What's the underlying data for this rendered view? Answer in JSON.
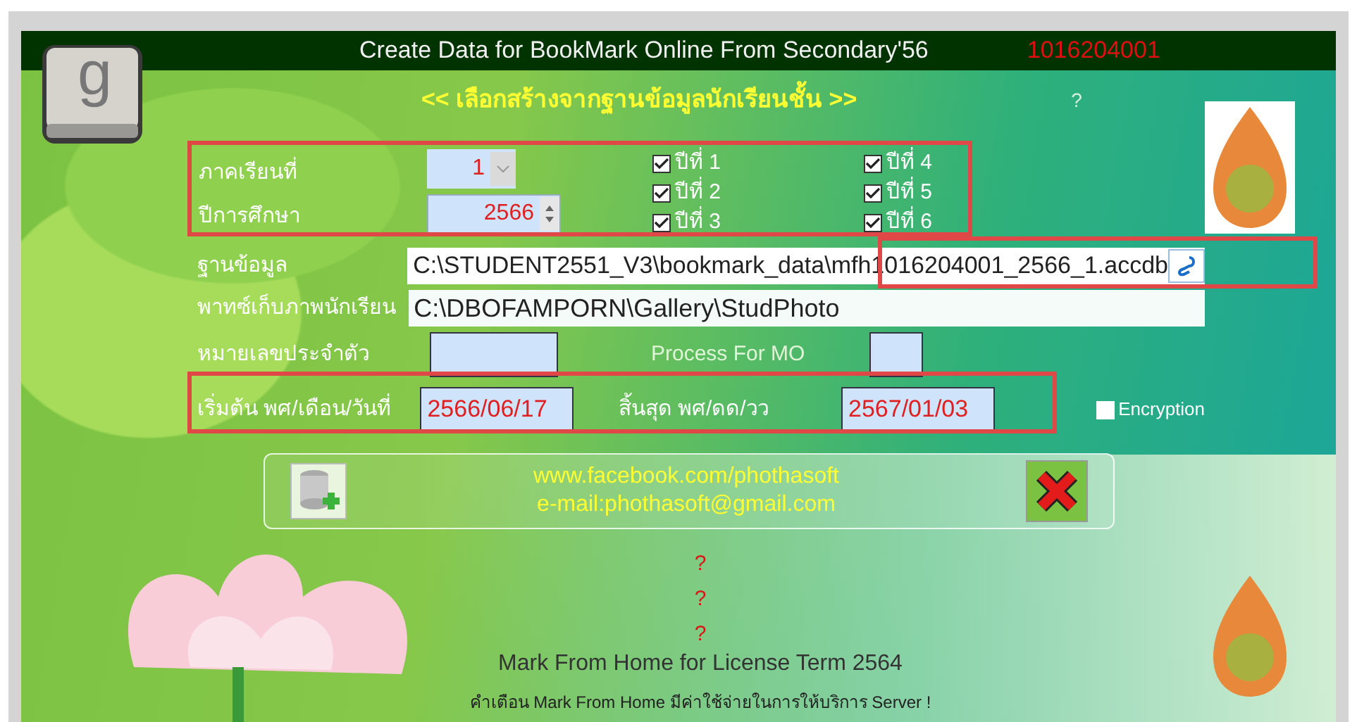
{
  "window": {
    "title": "Create Data for BookMark Online From Secondary'56",
    "code": "1016204001"
  },
  "logo": "g",
  "heading": "<< เลือกสร้างจากฐานข้อมูลนักเรียนชั้น >>",
  "help_mark": "?",
  "semester": {
    "label": "ภาคเรียนที่",
    "value": "1"
  },
  "year": {
    "label": "ปีการศึกษา",
    "value": "2566"
  },
  "grades": [
    {
      "label": "ปีที่ 1",
      "checked": true
    },
    {
      "label": "ปีที่ 2",
      "checked": true
    },
    {
      "label": "ปีที่ 3",
      "checked": true
    },
    {
      "label": "ปีที่ 4",
      "checked": true
    },
    {
      "label": "ปีที่ 5",
      "checked": true
    },
    {
      "label": "ปีที่ 6",
      "checked": true
    }
  ],
  "database": {
    "label": "ฐานข้อมูล",
    "value": "C:\\STUDENT2551_V3\\bookmark_data\\mfh1016204001_2566_1.accdb"
  },
  "photo_path": {
    "label": "พาทซ์เก็บภาพนักเรียน",
    "value": "C:\\DBOFAMPORN\\Gallery\\StudPhoto"
  },
  "id_number": {
    "label": "หมายเลขประจำตัว"
  },
  "process_mo": {
    "label": "Process For MO"
  },
  "start_date": {
    "label": "เริ่มต้น พศ/เดือน/วันที่",
    "value": "2566/06/17"
  },
  "end_date": {
    "label": "สิ้นสุด พศ/ดด/วว",
    "value": "2567/01/03"
  },
  "encryption": {
    "label": "Encryption",
    "checked": false
  },
  "links": [
    "www.facebook.com/phothasoft",
    "e-mail:phothasoft@gmail.com"
  ],
  "status_marks": [
    "?",
    "?",
    "?"
  ],
  "license": "Mark From Home for License Term 2564",
  "warning": "คำเตือน Mark From Home มีค่าใช้จ่ายในการให้บริการ Server !"
}
